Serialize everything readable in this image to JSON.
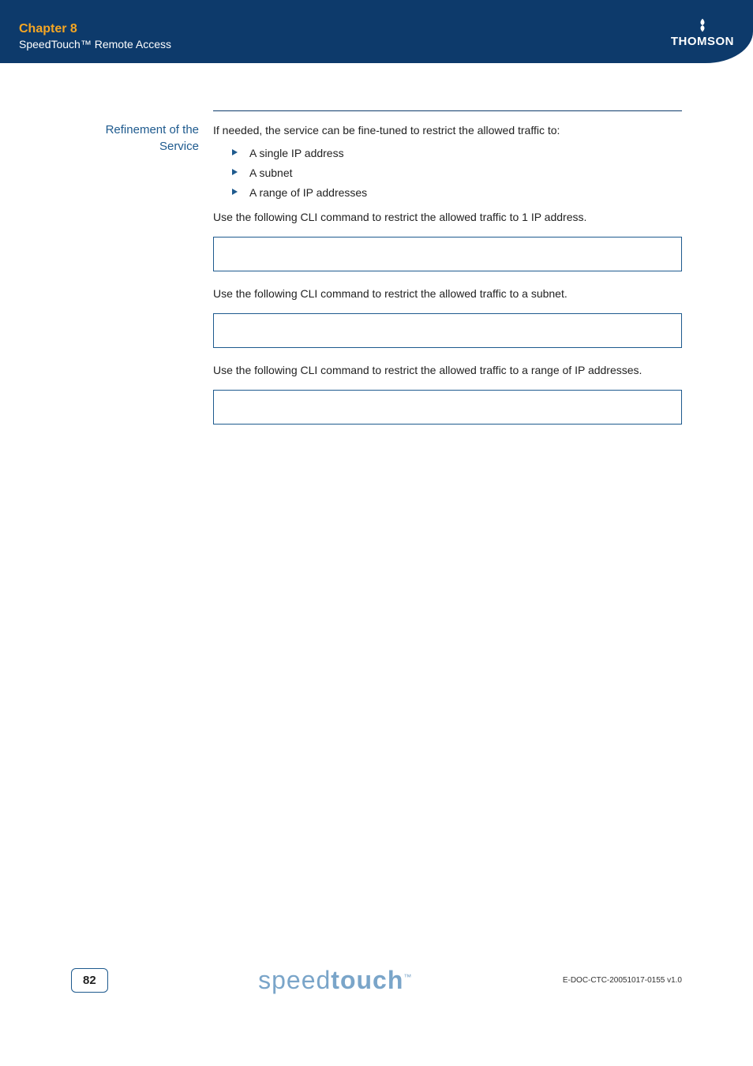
{
  "header": {
    "chapter": "Chapter 8",
    "subtitle": "SpeedTouch™ Remote Access",
    "brand": "THOMSON"
  },
  "section": {
    "label_line1": "Refinement of the",
    "label_line2": "Service",
    "intro": "If needed, the service can be fine-tuned to restrict the allowed traffic to:",
    "bullets": [
      "A single IP address",
      "A subnet",
      "A range of IP addresses"
    ],
    "cli_text_1": "Use the following CLI command to restrict the allowed traffic to 1 IP address.",
    "cli_text_2": "Use the following CLI command to restrict the allowed traffic to a subnet.",
    "cli_text_3": "Use the following CLI command to restrict the allowed traffic to a range of IP addresses."
  },
  "footer": {
    "page_number": "82",
    "logo_prefix": "speed",
    "logo_bold": "touch",
    "logo_tm": "™",
    "doc_id": "E-DOC-CTC-20051017-0155 v1.0"
  }
}
